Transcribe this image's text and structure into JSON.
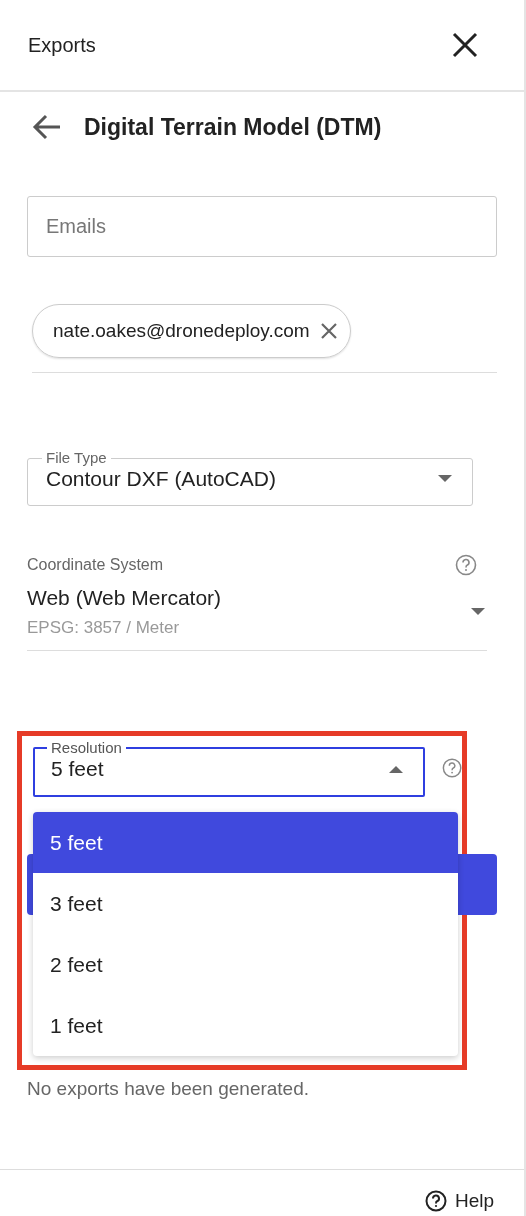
{
  "header": {
    "title": "Exports"
  },
  "page_title": "Digital Terrain Model (DTM)",
  "emails_field": {
    "placeholder": "Emails"
  },
  "email_chips": [
    {
      "text": "nate.oakes@dronedeploy.com"
    }
  ],
  "file_type": {
    "label": "File Type",
    "value": "Contour DXF (AutoCAD)"
  },
  "coordinate_system": {
    "label": "Coordinate System",
    "value": "Web (Web Mercator)",
    "detail": "EPSG: 3857 / Meter"
  },
  "resolution": {
    "label": "Resolution",
    "value": "5 feet",
    "expanded": true,
    "options": [
      {
        "label": "5 feet",
        "selected": true
      },
      {
        "label": "3 feet",
        "selected": false
      },
      {
        "label": "2 feet",
        "selected": false
      },
      {
        "label": "1 feet",
        "selected": false
      }
    ]
  },
  "empty_message": "No exports have been generated.",
  "footer": {
    "help": "Help"
  }
}
